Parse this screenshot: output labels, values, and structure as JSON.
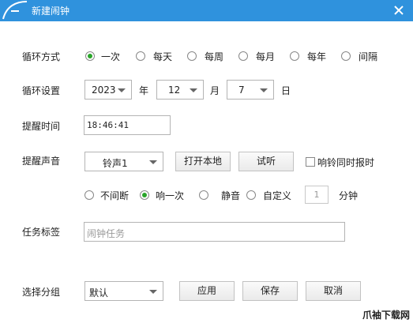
{
  "window": {
    "title": "新建闹钟"
  },
  "repeat": {
    "label": "循环方式",
    "options": [
      "一次",
      "每天",
      "每周",
      "每月",
      "每年",
      "间隔"
    ],
    "selected": "一次"
  },
  "settings": {
    "label": "循环设置",
    "year": "2023",
    "year_unit": "年",
    "month": "12",
    "month_unit": "月",
    "day": "7",
    "day_unit": "日"
  },
  "time": {
    "label": "提醒时间",
    "value": "18:46:41"
  },
  "sound": {
    "label": "提醒声音",
    "selected": "铃声1",
    "open_local": "打开本地",
    "test": "试听",
    "chime_label": "响铃同时报时",
    "chime_checked": false,
    "modes": [
      "不间断",
      "响一次",
      "静音",
      "自定义"
    ],
    "mode_selected": "响一次",
    "custom_minutes": "1",
    "minutes_unit": "分钟"
  },
  "task": {
    "label": "任务标签",
    "placeholder": "闹钟任务"
  },
  "group": {
    "label": "选择分组",
    "selected": "默认"
  },
  "buttons": {
    "apply": "应用",
    "save": "保存",
    "cancel": "取消"
  },
  "watermark": "爪袖下载网",
  "icons": {
    "logo": "app-logo-icon",
    "close": "close-icon"
  },
  "colors": {
    "titlebar": "#2f92dd",
    "radio_selected": "#2aa52a"
  }
}
